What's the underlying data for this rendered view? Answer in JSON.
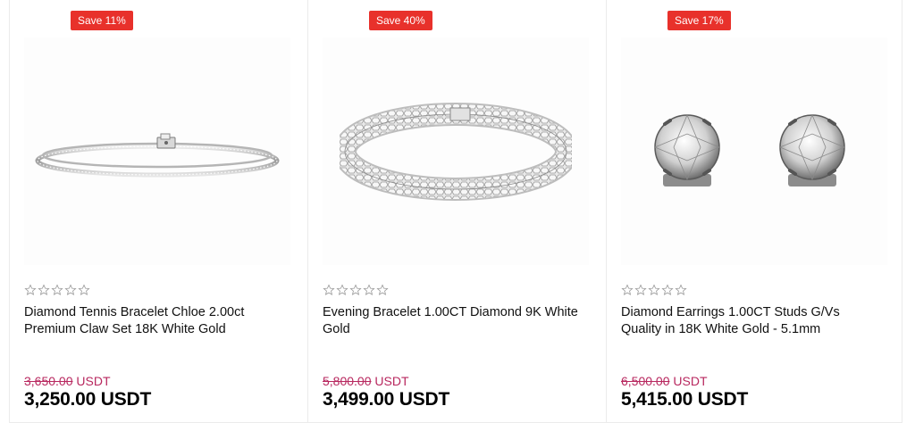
{
  "colors": {
    "badge": "#e8312b",
    "old_price": "#b8285f",
    "star_outline": "#9a9a9a"
  },
  "products": [
    {
      "badge": "Save 11%",
      "image_icon": "tennis-bracelet-image",
      "rating": 0,
      "title": "Diamond Tennis Bracelet Chloe 2.00ct Premium Claw Set 18K White Gold",
      "old_price_value": "3,650.00",
      "old_price_unit": "USDT",
      "price": "3,250.00 USDT"
    },
    {
      "badge": "Save 40%",
      "image_icon": "evening-bracelet-image",
      "rating": 0,
      "title": "Evening Bracelet 1.00CT Diamond 9K White Gold",
      "old_price_value": "5,800.00",
      "old_price_unit": "USDT",
      "price": "3,499.00 USDT"
    },
    {
      "badge": "Save 17%",
      "image_icon": "stud-earrings-image",
      "rating": 0,
      "title": "Diamond Earrings 1.00CT Studs G/Vs Quality in 18K White Gold - 5.1mm",
      "old_price_value": "6,500.00",
      "old_price_unit": "USDT",
      "price": "5,415.00 USDT"
    }
  ]
}
